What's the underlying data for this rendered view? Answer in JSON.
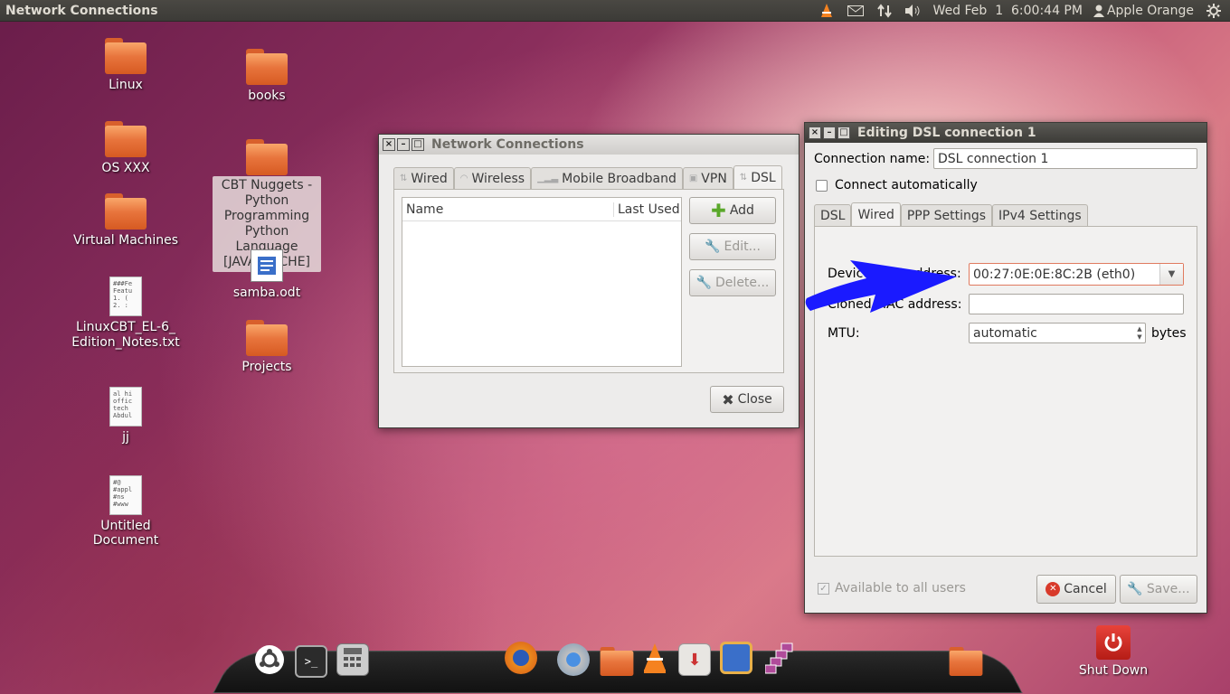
{
  "top_panel": {
    "title": "Network Connections",
    "clock": "Wed Feb  1  6:00:44 PM",
    "user": "Apple Orange"
  },
  "desktop": {
    "icons": [
      {
        "label": "Linux"
      },
      {
        "label": "OS XXX"
      },
      {
        "label": "Virtual Machines"
      },
      {
        "label": "LinuxCBT_EL-6_\nEdition_Notes.txt"
      },
      {
        "label": "jj"
      },
      {
        "label": "Untitled Document"
      },
      {
        "label": "books"
      },
      {
        "label": "CBT Nuggets - Python Programming Python Language [JAVAPSYCHE]"
      },
      {
        "label": "samba.odt"
      },
      {
        "label": "Projects"
      }
    ]
  },
  "network_window": {
    "title": "Network Connections",
    "tabs": [
      "Wired",
      "Wireless",
      "Mobile Broadband",
      "VPN",
      "DSL"
    ],
    "active_tab": "DSL",
    "columns": [
      "Name",
      "Last Used"
    ],
    "add_label": "Add",
    "edit_label": "Edit...",
    "delete_label": "Delete...",
    "close_label": "Close"
  },
  "dsl_window": {
    "title": "Editing DSL connection 1",
    "connection_name_label": "Connection name:",
    "connection_name_value": "DSL connection 1",
    "connect_auto_label": "Connect automatically",
    "tabs": [
      "DSL",
      "Wired",
      "PPP Settings",
      "IPv4 Settings"
    ],
    "active_tab": "Wired",
    "device_mac_label": "Device MAC address:",
    "device_mac_value": "00:27:0E:0E:8C:2B (eth0)",
    "cloned_mac_label": "Cloned MAC address:",
    "cloned_mac_value": "",
    "mtu_label": "MTU:",
    "mtu_value": "automatic",
    "mtu_unit": "bytes",
    "available_label": "Available to all users",
    "cancel_label": "Cancel",
    "save_label": "Save..."
  },
  "dock": {
    "shutdown_label": "Shut Down"
  },
  "colors": {
    "arrow": "#1a1aff",
    "panel": "#3c3b37"
  }
}
